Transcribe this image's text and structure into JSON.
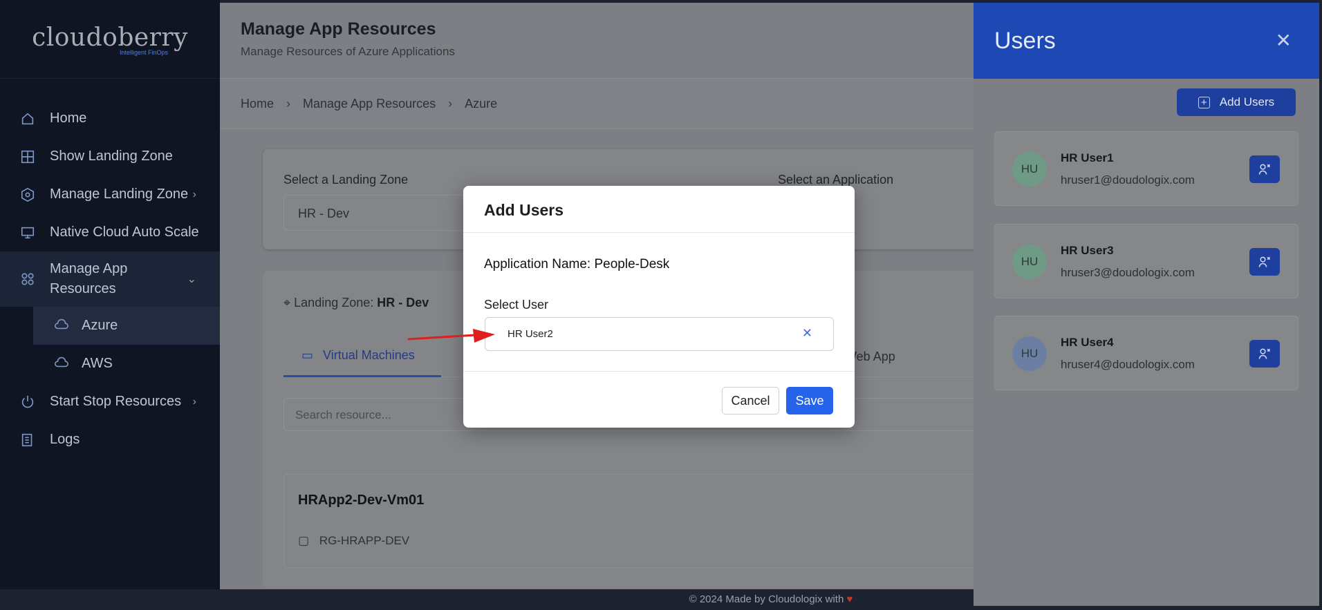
{
  "logo": {
    "name": "cloudoberry",
    "tagline": "Intelligent FinOps"
  },
  "sidebar": {
    "items": [
      {
        "label": "Home",
        "icon": "home-icon"
      },
      {
        "label": "Show Landing Zone",
        "icon": "grid-icon"
      },
      {
        "label": "Manage Landing Zone",
        "icon": "hexagon-icon"
      },
      {
        "label": "Native Cloud Auto Scale",
        "icon": "monitor-icon"
      },
      {
        "label": "Manage App Resources",
        "icon": "apps-icon"
      },
      {
        "label": "Start Stop Resources",
        "icon": "power-icon"
      },
      {
        "label": "Logs",
        "icon": "logs-icon"
      }
    ],
    "sub_items": [
      {
        "label": "Azure",
        "icon": "cloud-icon"
      },
      {
        "label": "AWS",
        "icon": "cloud-icon"
      }
    ]
  },
  "header": {
    "title": "Manage App Resources",
    "subtitle": "Manage Resources of Azure Applications"
  },
  "breadcrumb": [
    "Home",
    "Manage App Resources",
    "Azure"
  ],
  "filters": {
    "landing_zone_label": "Select a Landing Zone",
    "landing_zone_value": "HR - Dev",
    "application_label": "Select an Application"
  },
  "resources": {
    "landing_zone_text": "Landing Zone:",
    "landing_zone_value": "HR - Dev",
    "tab_vm": "Virtual Machines",
    "tab_webapp": "Web App",
    "search_placeholder": "Search resource...",
    "vm_name": "HRApp2-Dev-Vm01",
    "resource_group": "RG-HRAPP-DEV"
  },
  "footer": {
    "text": "© 2024 Made by Cloudologix with"
  },
  "users_panel": {
    "title": "Users",
    "add_button": "Add Users",
    "users": [
      {
        "initials": "HU",
        "name": "HR User1",
        "email": "hruser1@doudologix.com",
        "color": "#6f9a85"
      },
      {
        "initials": "HU",
        "name": "HR User3",
        "email": "hruser3@doudologix.com",
        "color": "#6f9a85"
      },
      {
        "initials": "HU",
        "name": "HR User4",
        "email": "hruser4@doudologix.com",
        "color": "#6b7fa3"
      }
    ]
  },
  "modal": {
    "title": "Add Users",
    "app_name_label": "Application Name:",
    "app_name_value": "People-Desk",
    "select_user_label": "Select User",
    "selected_user": "HR User2",
    "cancel": "Cancel",
    "save": "Save"
  },
  "colors": {
    "accent": "#2563eb",
    "panel_header": "#1e48b4",
    "sidebar": "#0f1522"
  }
}
